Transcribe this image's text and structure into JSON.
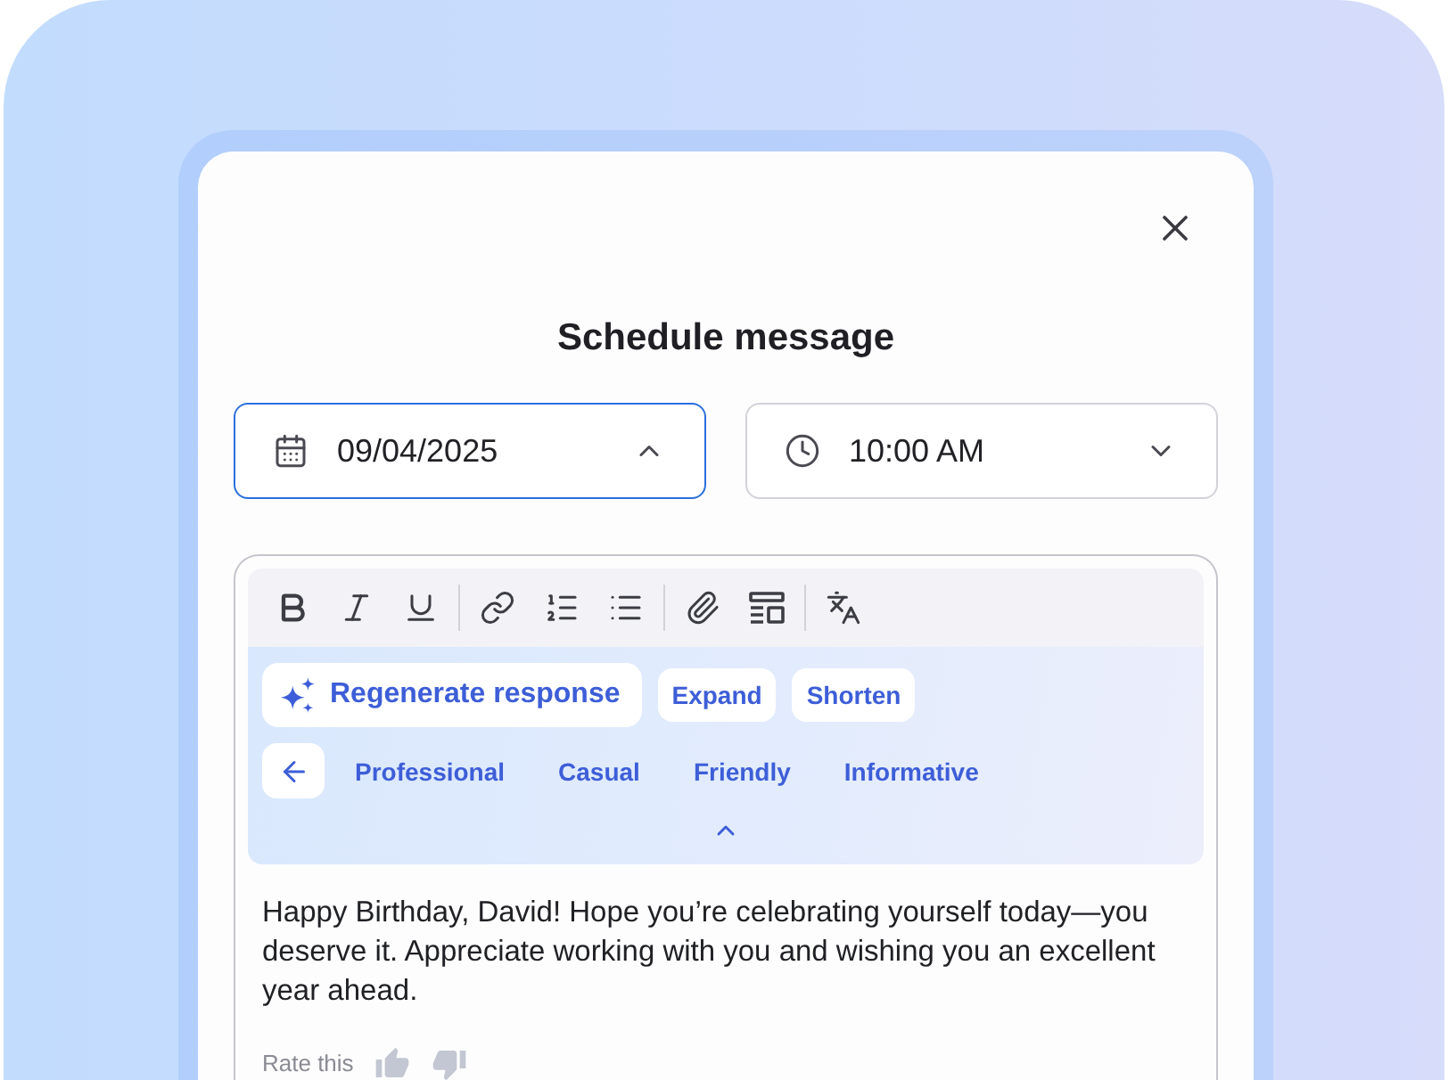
{
  "dialog": {
    "title": "Schedule message"
  },
  "date_field": {
    "value": "09/04/2025",
    "expanded": true
  },
  "time_field": {
    "value": "10:00 AM",
    "expanded": false
  },
  "ai_panel": {
    "expanded": true,
    "regenerate": "Regenerate response",
    "actions": [
      "Expand",
      "Shorten"
    ],
    "tones": [
      "Professional",
      "Casual",
      "Friendly",
      "Informative"
    ]
  },
  "message": {
    "text": "Happy Birthday, David! Hope you’re celebrating yourself today—you deserve it. Appreciate working with you and wishing you an excellent year ahead."
  },
  "rating": {
    "label": "Rate this"
  }
}
